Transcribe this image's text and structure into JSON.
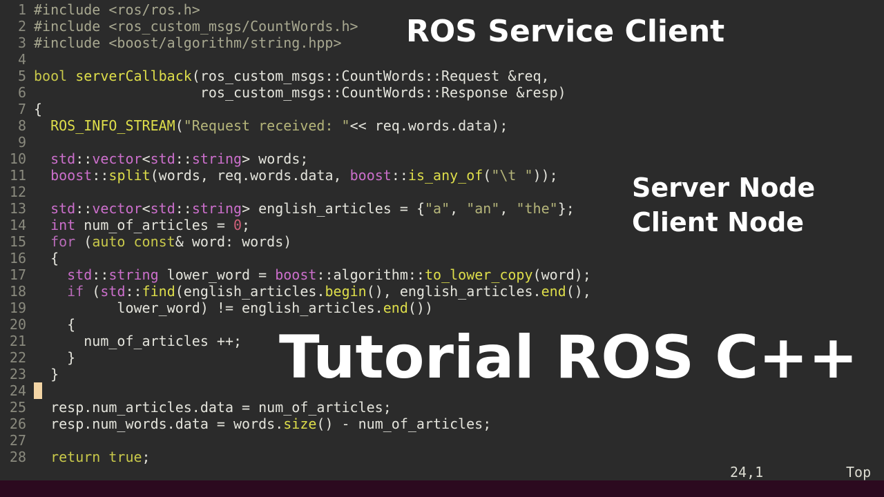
{
  "editor": {
    "cursor_line": 24,
    "lines": [
      {
        "n": "1",
        "segs": [
          {
            "t": "#include <ros/ros.h>",
            "c": "pp"
          }
        ]
      },
      {
        "n": "2",
        "segs": [
          {
            "t": "#include <ros_custom_msgs/CountWords.h>",
            "c": "pp"
          }
        ]
      },
      {
        "n": "3",
        "segs": [
          {
            "t": "#include <boost/algorithm/string.hpp>",
            "c": "pp"
          }
        ]
      },
      {
        "n": "4",
        "segs": []
      },
      {
        "n": "5",
        "segs": [
          {
            "t": "bool ",
            "c": "kw"
          },
          {
            "t": "serverCallback",
            "c": "fn"
          },
          {
            "t": "(ros_custom_msgs::CountWords::Request &req,",
            "c": "tx"
          }
        ]
      },
      {
        "n": "6",
        "segs": [
          {
            "t": "                    ros_custom_msgs::CountWords::Response &resp)",
            "c": "tx"
          }
        ]
      },
      {
        "n": "7",
        "segs": [
          {
            "t": "{",
            "c": "tx"
          }
        ]
      },
      {
        "n": "8",
        "segs": [
          {
            "t": "  ",
            "c": "tx"
          },
          {
            "t": "ROS_INFO_STREAM",
            "c": "fn"
          },
          {
            "t": "(",
            "c": "tx"
          },
          {
            "t": "\"Request received: \"",
            "c": "str"
          },
          {
            "t": "<< req.words.data);",
            "c": "tx"
          }
        ]
      },
      {
        "n": "9",
        "segs": []
      },
      {
        "n": "10",
        "segs": [
          {
            "t": "  ",
            "c": "tx"
          },
          {
            "t": "std",
            "c": "ty"
          },
          {
            "t": "::",
            "c": "tx"
          },
          {
            "t": "vector",
            "c": "ty"
          },
          {
            "t": "<",
            "c": "tx"
          },
          {
            "t": "std",
            "c": "ty"
          },
          {
            "t": "::",
            "c": "tx"
          },
          {
            "t": "string",
            "c": "ty"
          },
          {
            "t": "> words;",
            "c": "tx"
          }
        ]
      },
      {
        "n": "11",
        "segs": [
          {
            "t": "  ",
            "c": "tx"
          },
          {
            "t": "boost",
            "c": "ty"
          },
          {
            "t": "::",
            "c": "tx"
          },
          {
            "t": "split",
            "c": "fn"
          },
          {
            "t": "(words, req.words.data, ",
            "c": "tx"
          },
          {
            "t": "boost",
            "c": "ty"
          },
          {
            "t": "::",
            "c": "tx"
          },
          {
            "t": "is_any_of",
            "c": "fn"
          },
          {
            "t": "(",
            "c": "tx"
          },
          {
            "t": "\"\\t \"",
            "c": "str"
          },
          {
            "t": "));",
            "c": "tx"
          }
        ]
      },
      {
        "n": "12",
        "segs": []
      },
      {
        "n": "13",
        "segs": [
          {
            "t": "  ",
            "c": "tx"
          },
          {
            "t": "std",
            "c": "ty"
          },
          {
            "t": "::",
            "c": "tx"
          },
          {
            "t": "vector",
            "c": "ty"
          },
          {
            "t": "<",
            "c": "tx"
          },
          {
            "t": "std",
            "c": "ty"
          },
          {
            "t": "::",
            "c": "tx"
          },
          {
            "t": "string",
            "c": "ty"
          },
          {
            "t": "> english_articles = {",
            "c": "tx"
          },
          {
            "t": "\"a\"",
            "c": "str"
          },
          {
            "t": ", ",
            "c": "tx"
          },
          {
            "t": "\"an\"",
            "c": "str"
          },
          {
            "t": ", ",
            "c": "tx"
          },
          {
            "t": "\"the\"",
            "c": "str"
          },
          {
            "t": "};",
            "c": "tx"
          }
        ]
      },
      {
        "n": "14",
        "segs": [
          {
            "t": "  ",
            "c": "tx"
          },
          {
            "t": "int",
            "c": "ty"
          },
          {
            "t": " num_of_articles = ",
            "c": "tx"
          },
          {
            "t": "0",
            "c": "num"
          },
          {
            "t": ";",
            "c": "tx"
          }
        ]
      },
      {
        "n": "15",
        "segs": [
          {
            "t": "  ",
            "c": "tx"
          },
          {
            "t": "for",
            "c": "kw2"
          },
          {
            "t": " (",
            "c": "tx"
          },
          {
            "t": "auto const",
            "c": "kw"
          },
          {
            "t": "& word: words)",
            "c": "tx"
          }
        ]
      },
      {
        "n": "16",
        "segs": [
          {
            "t": "  {",
            "c": "tx"
          }
        ]
      },
      {
        "n": "17",
        "segs": [
          {
            "t": "    ",
            "c": "tx"
          },
          {
            "t": "std",
            "c": "ty"
          },
          {
            "t": "::",
            "c": "tx"
          },
          {
            "t": "string",
            "c": "ty"
          },
          {
            "t": " lower_word = ",
            "c": "tx"
          },
          {
            "t": "boost",
            "c": "ty"
          },
          {
            "t": "::algorithm::",
            "c": "tx"
          },
          {
            "t": "to_lower_copy",
            "c": "fn"
          },
          {
            "t": "(word);",
            "c": "tx"
          }
        ]
      },
      {
        "n": "18",
        "segs": [
          {
            "t": "    ",
            "c": "tx"
          },
          {
            "t": "if",
            "c": "kw2"
          },
          {
            "t": " (",
            "c": "tx"
          },
          {
            "t": "std",
            "c": "ty"
          },
          {
            "t": "::",
            "c": "tx"
          },
          {
            "t": "find",
            "c": "fn"
          },
          {
            "t": "(english_articles.",
            "c": "tx"
          },
          {
            "t": "begin",
            "c": "fn"
          },
          {
            "t": "(), english_articles.",
            "c": "tx"
          },
          {
            "t": "end",
            "c": "fn"
          },
          {
            "t": "(),",
            "c": "tx"
          }
        ]
      },
      {
        "n": "19",
        "segs": [
          {
            "t": "          lower_word) != english_articles.",
            "c": "tx"
          },
          {
            "t": "end",
            "c": "fn"
          },
          {
            "t": "())",
            "c": "tx"
          }
        ]
      },
      {
        "n": "20",
        "segs": [
          {
            "t": "    {",
            "c": "tx"
          }
        ]
      },
      {
        "n": "21",
        "segs": [
          {
            "t": "      num_of_articles ++;",
            "c": "tx"
          }
        ]
      },
      {
        "n": "22",
        "segs": [
          {
            "t": "    }",
            "c": "tx"
          }
        ]
      },
      {
        "n": "23",
        "segs": [
          {
            "t": "  }",
            "c": "tx"
          }
        ]
      },
      {
        "n": "24",
        "segs": []
      },
      {
        "n": "25",
        "segs": [
          {
            "t": "  resp.num_articles.data = num_of_articles;",
            "c": "tx"
          }
        ]
      },
      {
        "n": "26",
        "segs": [
          {
            "t": "  resp.num_words.data = words.",
            "c": "tx"
          },
          {
            "t": "size",
            "c": "fn"
          },
          {
            "t": "() - num_of_articles;",
            "c": "tx"
          }
        ]
      },
      {
        "n": "27",
        "segs": []
      },
      {
        "n": "28",
        "segs": [
          {
            "t": "  ",
            "c": "tx"
          },
          {
            "t": "return true",
            "c": "kw"
          },
          {
            "t": ";",
            "c": "tx"
          }
        ]
      }
    ]
  },
  "status": {
    "position": "24,1",
    "scroll": "Top"
  },
  "overlay": {
    "title": "ROS Service Client",
    "server": "Server Node",
    "client": "Client Node",
    "tutorial": "Tutorial ROS C++"
  },
  "colors": {
    "pp": "#a8a890",
    "kw": "#c9c94a",
    "kw2": "#b86bb8",
    "fn": "#dede4a",
    "tx": "#e4e4dc",
    "str": "#b5b57a",
    "ty": "#cc6fcc",
    "num": "#d0607a"
  }
}
